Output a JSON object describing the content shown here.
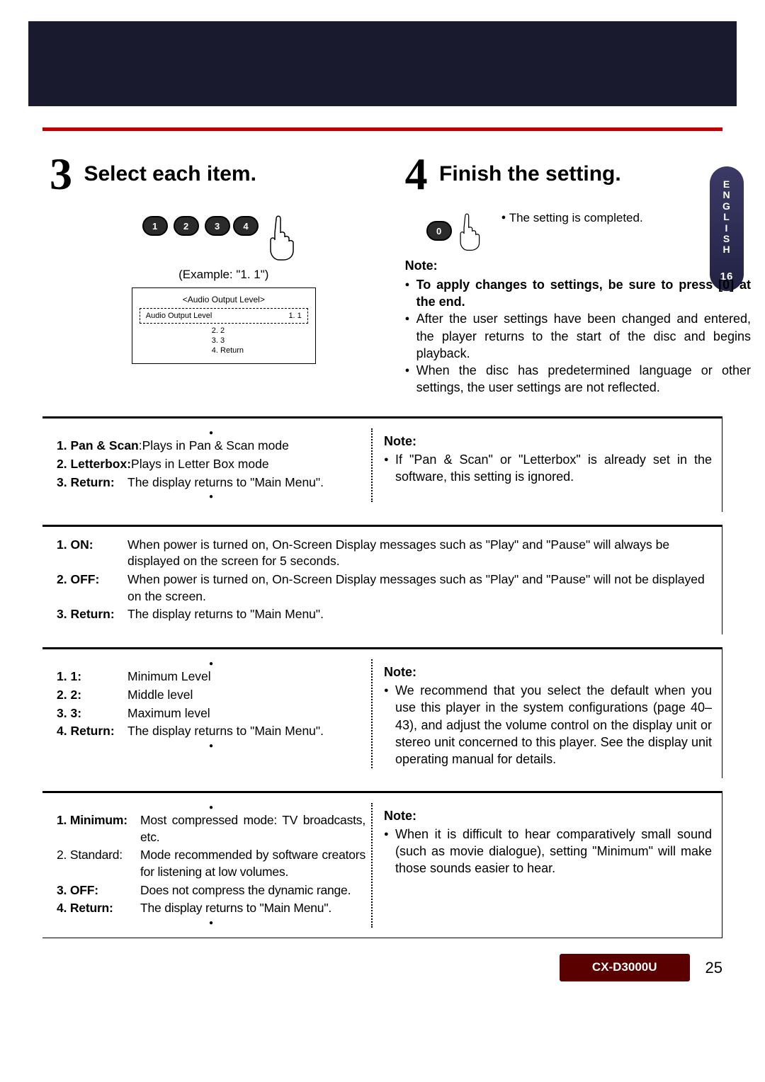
{
  "side_tab": {
    "letters": [
      "E",
      "N",
      "G",
      "L",
      "I",
      "S",
      "H"
    ],
    "page": "16"
  },
  "step3": {
    "title": "Select each item.",
    "keys": [
      "1",
      "2",
      "3",
      "4"
    ],
    "example": "(Example: \"1. 1\")",
    "screen_title": "<Audio Output Level>",
    "screen_row_label": "Audio Output Level",
    "screen_row_val": "1. 1",
    "screen_list": [
      "2. 2",
      "3. 3",
      "4. Return"
    ]
  },
  "step4": {
    "title": "Finish the setting.",
    "key": "0",
    "done": "The setting is completed.",
    "note_head": "Note:",
    "notes_bold": "To apply changes to settings, be sure to press [0] at the end.",
    "notes": [
      "After the user settings have been changed and entered, the player returns to the start of the disc and begins playback.",
      "When the disc has predetermined language or other settings, the user settings are not reflected."
    ]
  },
  "sec1": {
    "items": [
      {
        "label": "1. Pan & Scan",
        "desc": ":Plays in Pan & Scan mode"
      },
      {
        "label": "2. Letterbox",
        "sep": ": ",
        "desc": "Plays in Letter Box mode"
      },
      {
        "label": "3. Return",
        "sep": ":",
        "desc": "The display returns to \"Main Menu\"."
      }
    ],
    "note_head": "Note:",
    "note": "If \"Pan & Scan\" or \"Letterbox\" is already set in the software, this setting is ignored."
  },
  "sec2": {
    "items": [
      {
        "label": "1. ON",
        "sep": ":",
        "desc": "When power is turned on, On-Screen Display messages such as \"Play\" and \"Pause\" will always be displayed on the screen for 5 seconds."
      },
      {
        "label": "2. OFF",
        "sep": ":",
        "desc": "When power is turned on, On-Screen Display messages such as \"Play\" and \"Pause\" will not be displayed on the screen."
      },
      {
        "label": "3. Return",
        "sep": ":",
        "desc": "The display returns to \"Main Menu\"."
      }
    ]
  },
  "sec3": {
    "items": [
      {
        "label": "1. 1",
        "sep": ":",
        "desc": "Minimum Level"
      },
      {
        "label": "2. 2",
        "sep": ":",
        "desc": "Middle level"
      },
      {
        "label": "3. 3",
        "sep": ":",
        "desc": "Maximum level"
      },
      {
        "label": "4. Return",
        "sep": ":",
        "desc": "The display returns to \"Main Menu\"."
      }
    ],
    "note_head": "Note:",
    "note": "We recommend that you select the default when you use this player in the system configurations (page 40–43), and adjust the volume control on the display unit or stereo unit concerned to this player. See the display unit operating manual for details."
  },
  "sec4": {
    "items": [
      {
        "label": "1. Minimum",
        "sep": ": ",
        "desc": "Most compressed mode: TV broadcasts, etc."
      },
      {
        "label": "2. Standard",
        "sep": ": ",
        "desc": "Mode recommended by software creators for listening at low volumes."
      },
      {
        "label": "3. OFF",
        "sep": ":",
        "desc": "Does not compress the dynamic range."
      },
      {
        "label": "4. Return",
        "sep": ":",
        "desc": "The display returns to \"Main Menu\"."
      }
    ],
    "note_head": "Note:",
    "note": "When it is difficult to hear comparatively small sound (such as movie dialogue), setting \"Minimum\" will make those sounds easier to hear."
  },
  "footer": {
    "model": "CX-D3000U",
    "page": "25"
  }
}
